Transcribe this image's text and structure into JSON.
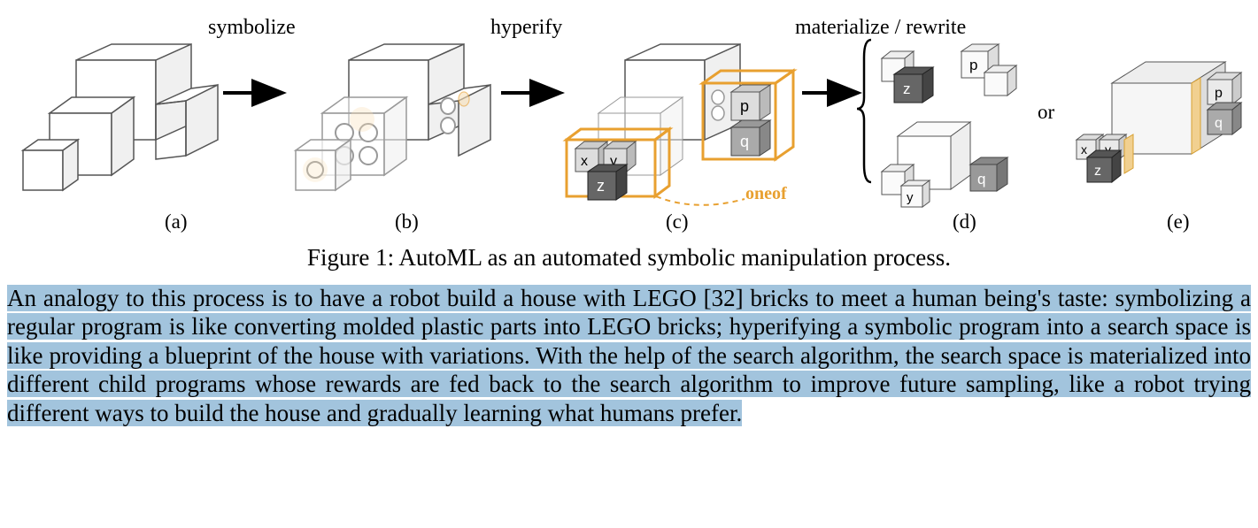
{
  "figure": {
    "labels": {
      "symbolize": "symbolize",
      "hyperify": "hyperify",
      "materialize": "materialize / rewrite",
      "oneof": "oneof",
      "or": "or",
      "a": "(a)",
      "b": "(b)",
      "c": "(c)",
      "d": "(d)",
      "e": "(e)"
    },
    "smallbox_labels": {
      "x": "x",
      "y": "y",
      "z": "z",
      "p": "p",
      "q": "q"
    },
    "caption_lead": "Figure 1:",
    "caption_text": " AutoML as an automated symbolic manipulation process."
  },
  "paragraph": {
    "text": "An analogy to this process is to have a robot build a house with LEGO [32] bricks to meet a human being's taste: symbolizing a regular program is like converting molded plastic parts into LEGO bricks; hyperifying a symbolic program into a search space is like providing a blueprint of the house with variations. With the help of the search algorithm, the search space is materialized into different child programs whose rewards are fed back to the search algorithm to improve future sampling, like a robot trying different ways to build the house and gradually learning what humans prefer."
  }
}
